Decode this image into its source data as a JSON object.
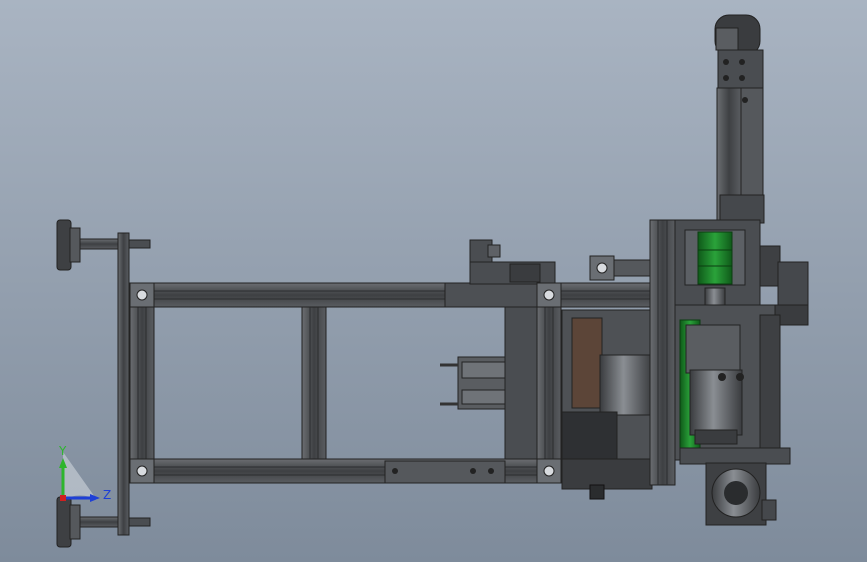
{
  "viewport": {
    "background_top": "#a9b4c2",
    "background_bottom": "#7e8b9b",
    "model_dark": "#3b3d40",
    "model_mid": "#55585c",
    "model_light": "#7a7e83",
    "accent_green": "#1f7a2a"
  },
  "triad": {
    "y_label": "Y",
    "z_label": "Z",
    "y_color": "#2db52d",
    "z_color": "#1e3fd6",
    "x_color": "#d02020"
  }
}
